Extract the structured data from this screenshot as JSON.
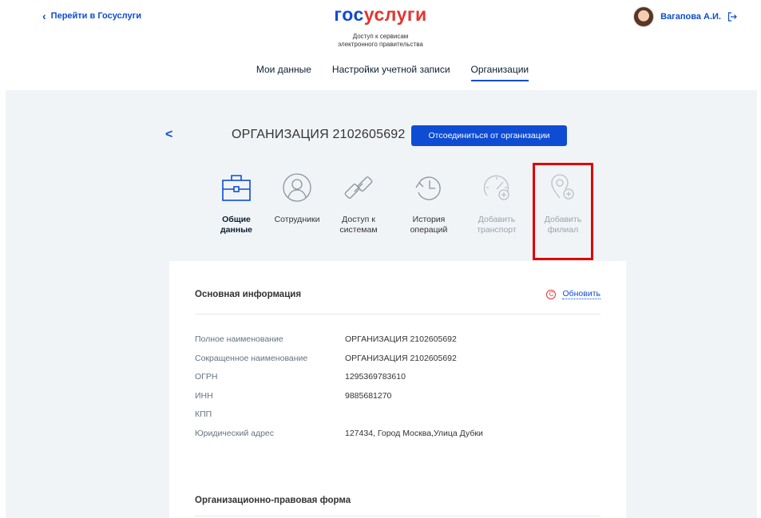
{
  "header": {
    "back_link": "Перейти в Госуслуги",
    "logo_part1": "гос",
    "logo_part2": "услуги",
    "tagline_line1": "Доступ к сервисам",
    "tagline_line2": "электронного правительства",
    "user_name": "Вагапова А.И."
  },
  "nav": {
    "tabs": [
      {
        "label": "Мои данные"
      },
      {
        "label": "Настройки учетной записи"
      },
      {
        "label": "Организации",
        "active": true
      }
    ]
  },
  "org": {
    "title": "ОРГАНИЗАЦИЯ 2102605692",
    "disconnect_label": "Отсоединиться от организации"
  },
  "tiles": [
    {
      "line1": "Общие",
      "line2": "данные",
      "icon": "briefcase-icon",
      "state": "active"
    },
    {
      "line1": "Сотрудники",
      "line2": "",
      "icon": "user-circle-icon",
      "state": "normal"
    },
    {
      "line1": "Доступ к",
      "line2": "системам",
      "icon": "link-icon",
      "state": "normal"
    },
    {
      "line1": "История",
      "line2": "операций",
      "icon": "history-icon",
      "state": "normal"
    },
    {
      "line1": "Добавить",
      "line2": "транспорт",
      "icon": "speedometer-add-icon",
      "state": "disabled"
    },
    {
      "line1": "Добавить",
      "line2": "филиал",
      "icon": "location-add-icon",
      "state": "disabled"
    }
  ],
  "card": {
    "heading": "Основная информация",
    "refresh_label": "Обновить",
    "rows": [
      {
        "key": "Полное наименование",
        "value": "ОРГАНИЗАЦИЯ 2102605692"
      },
      {
        "key": "Сокращенное наименование",
        "value": "ОРГАНИЗАЦИЯ 2102605692"
      },
      {
        "key": "ОГРН",
        "value": "1295369783610"
      },
      {
        "key": "ИНН",
        "value": "9885681270"
      },
      {
        "key": "КПП",
        "value": ""
      },
      {
        "key": "Юридический адрес",
        "value": "127434, Город Москва,Улица Дубки"
      }
    ],
    "section2_heading": "Организационно-правовая форма"
  },
  "colors": {
    "accent": "#0d4cd3",
    "brand_red": "#e3342f",
    "highlight": "#e00000",
    "background": "#f1f4f7"
  }
}
